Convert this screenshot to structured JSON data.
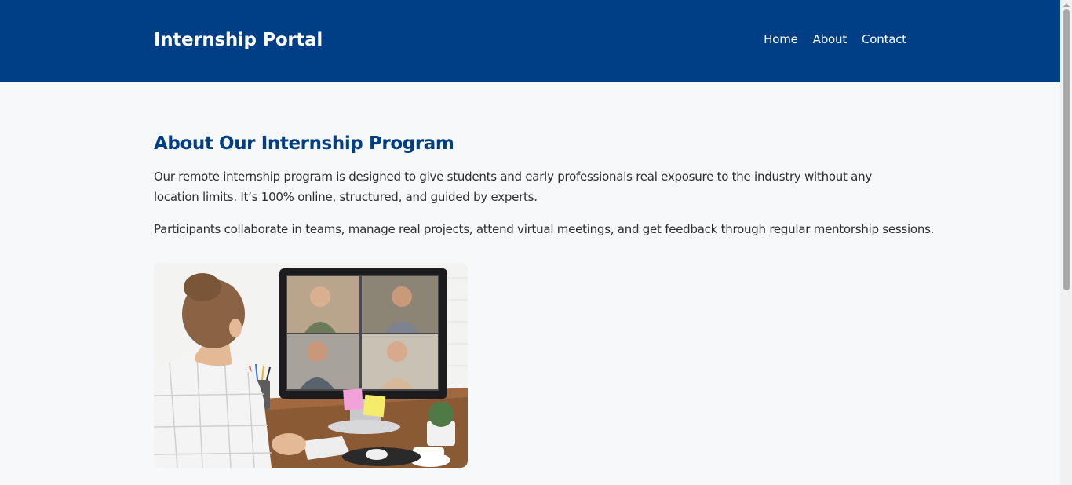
{
  "header": {
    "brand": "Internship Portal",
    "nav": [
      "Home",
      "About",
      "Contact"
    ],
    "background_color": "#003e85"
  },
  "main": {
    "title": "About Our Internship Program",
    "paragraphs": [
      "Our remote internship program is designed to give students and early professionals real exposure to the industry without any location limits. It’s 100% online, structured, and guided by experts.",
      "Participants collaborate in teams, manage real projects, attend virtual meetings, and get feedback through regular mentorship sessions."
    ],
    "title_color": "#003e85"
  },
  "colors": {
    "page_background": "#f7f8fa",
    "text": "#2d2d2d"
  }
}
